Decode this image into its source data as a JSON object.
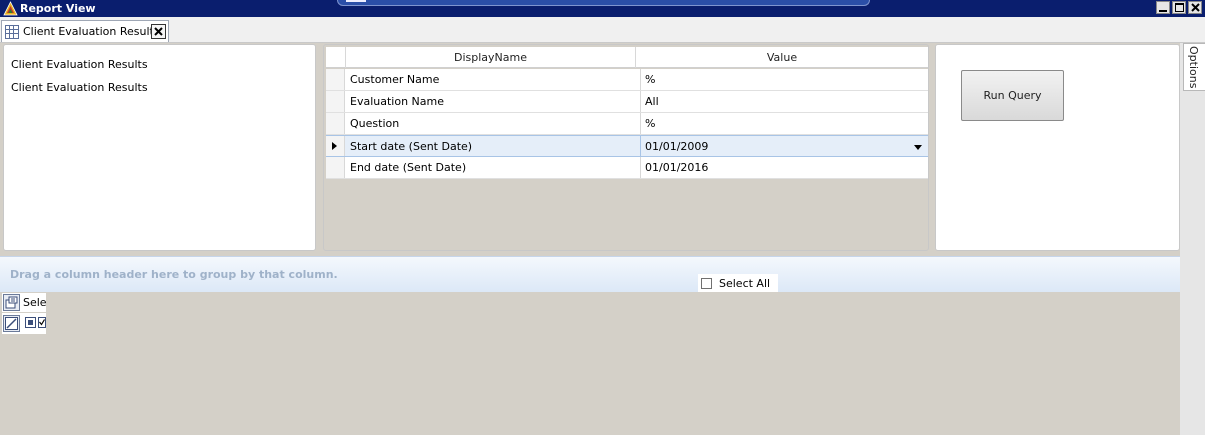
{
  "window": {
    "title": "Report View",
    "icon": "app-logo-icon"
  },
  "tabs": [
    {
      "label": "Client Evaluation Results",
      "icon": "grid-icon",
      "close_icon": "close-icon"
    }
  ],
  "left_panel": {
    "items": [
      "Client Evaluation Results",
      "Client Evaluation Results"
    ]
  },
  "parameters_grid": {
    "columns": [
      "DisplayName",
      "Value"
    ],
    "rows": [
      {
        "name": "Customer Name",
        "value": "%"
      },
      {
        "name": "Evaluation Name",
        "value": "All"
      },
      {
        "name": "Question",
        "value": "%"
      },
      {
        "name": "Start date (Sent Date)",
        "value": "01/01/2009",
        "selected": true,
        "dropdown": true
      },
      {
        "name": "End date (Sent Date)",
        "value": "01/01/2016"
      }
    ]
  },
  "right_panel": {
    "run_query_label": "Run Query"
  },
  "side_tab": {
    "label": "Options"
  },
  "results": {
    "group_by_hint": "Drag a column header here to group by that column.",
    "select_all_label": "Select All",
    "select_column_label": "Sele"
  },
  "colors": {
    "titlebar": "#0a1e6e",
    "background": "#d4d0c8",
    "selected_row": "#e5eef9",
    "group_band": "#dce8f7"
  }
}
